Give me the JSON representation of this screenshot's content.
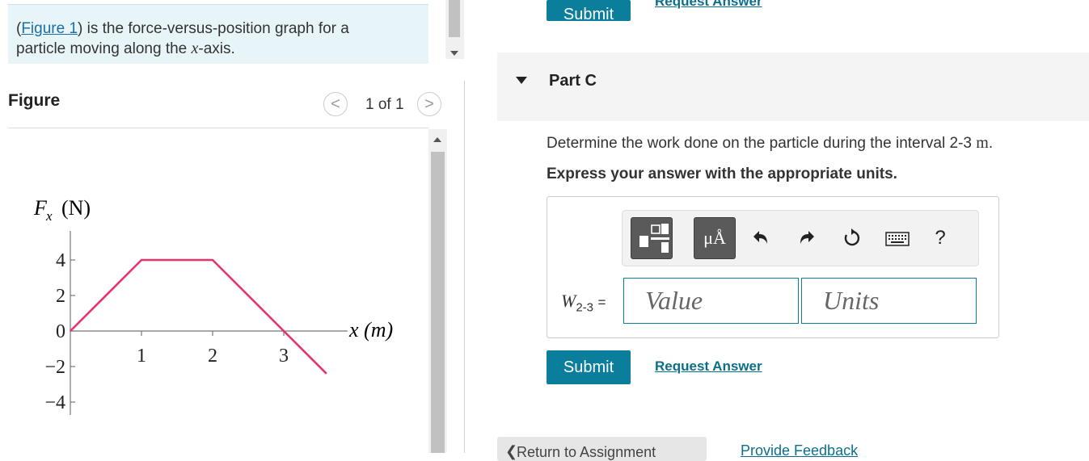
{
  "intro": {
    "link": "Figure 1",
    "text_prefix": "(",
    "text_mid": ") is the force-versus-position graph for a particle moving along the ",
    "var": "x",
    "text_suffix": "-axis."
  },
  "figure": {
    "heading": "Figure",
    "pager": "1 of 1",
    "prev_glyph": "<",
    "next_glyph": ">"
  },
  "chart_data": {
    "type": "line",
    "ylabel_main": "F",
    "ylabel_sub": "x",
    "ylabel_unit": "(N)",
    "xlabel": "x (m)",
    "x_ticks": [
      "1",
      "2",
      "3"
    ],
    "y_ticks": [
      "4",
      "2",
      "0",
      "−2",
      "−4"
    ],
    "xlim": [
      0,
      3.6
    ],
    "ylim": [
      -4,
      4
    ],
    "series": [
      {
        "color": "#e8326c",
        "x": [
          0,
          1,
          2,
          3,
          3.6
        ],
        "y": [
          0,
          4,
          4,
          0,
          -2.4
        ]
      }
    ]
  },
  "top": {
    "submit": "Submit",
    "request_answer": "Request Answer"
  },
  "partc": {
    "title": "Part C",
    "question": "Determine the work done on the particle during the interval 2-3 ",
    "question_unit": "m",
    "question_end": ".",
    "instruction": "Express your answer with the appropriate units.",
    "units_btn": "μÅ",
    "help": "?",
    "var_name": "W",
    "var_sub": "2-3",
    "equals": "=",
    "value_placeholder": "Value",
    "units_placeholder": "Units",
    "submit": "Submit",
    "request_answer": "Request Answer"
  },
  "footer": {
    "back": "Return to Assignment",
    "feedback": "Provide Feedback"
  }
}
